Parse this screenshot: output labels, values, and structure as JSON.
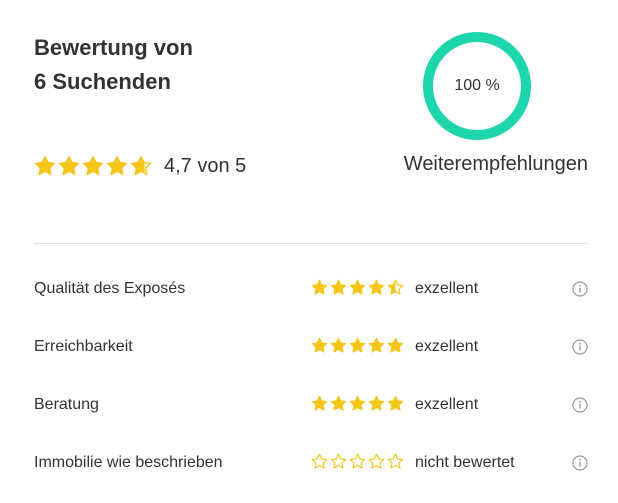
{
  "summary": {
    "title_line1": "Bewertung von",
    "title_line2": "6 Suchenden",
    "rating_value": 4.7,
    "rating_text": "4,7 von 5",
    "star_color": "#f5c518"
  },
  "recommendation": {
    "percent": 100,
    "percent_text": "100 %",
    "label": "Weiterempfehlungen",
    "ring_color": "#1dd6ac"
  },
  "categories": [
    {
      "label": "Qualität des Exposés",
      "rating": 4.5,
      "value_text": "exzellent",
      "info_icon": "info-icon"
    },
    {
      "label": "Erreichbarkeit",
      "rating": 5,
      "value_text": "exzellent",
      "info_icon": "info-icon"
    },
    {
      "label": "Beratung",
      "rating": 5,
      "value_text": "exzellent",
      "info_icon": "info-icon"
    },
    {
      "label": "Immobilie wie beschrieben",
      "rating": 0,
      "value_text": "nicht bewertet",
      "info_icon": "info-icon"
    }
  ]
}
